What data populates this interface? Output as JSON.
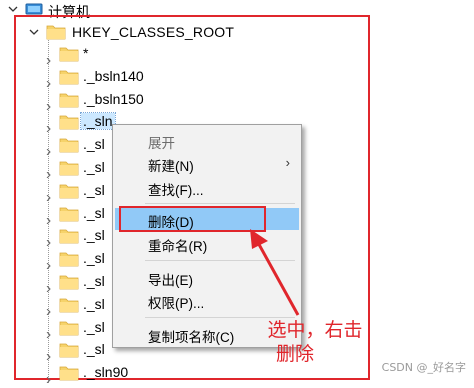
{
  "tree": {
    "root_label": "计算机",
    "hive_label": "HKEY_CLASSES_ROOT",
    "items": [
      {
        "label": "*"
      },
      {
        "label": "._bsln140"
      },
      {
        "label": "._bsln150"
      },
      {
        "label": "._sln"
      },
      {
        "label": "._sl"
      },
      {
        "label": "._sl"
      },
      {
        "label": "._sl"
      },
      {
        "label": "._sl"
      },
      {
        "label": "._sl"
      },
      {
        "label": "._sl"
      },
      {
        "label": "._sl"
      },
      {
        "label": "._sl"
      },
      {
        "label": "._sl"
      },
      {
        "label": "._sl"
      },
      {
        "label": "._sln90"
      }
    ],
    "selected_index": 3
  },
  "context_menu": {
    "expand": "展开",
    "new": "新建(N)",
    "find": "查找(F)...",
    "delete": "删除(D)",
    "rename": "重命名(R)",
    "export": "导出(E)",
    "permissions": "权限(P)...",
    "copy_key_name": "复制项名称(C)",
    "submenu_arrow": "›"
  },
  "annotation": {
    "line1": "选中，右击",
    "line2": "删除"
  },
  "watermark": "CSDN @_好名字",
  "colors": {
    "annotation_red": "#e0262c",
    "menu_highlight": "#91c9f7",
    "folder_yellow": "#f6d36b"
  }
}
